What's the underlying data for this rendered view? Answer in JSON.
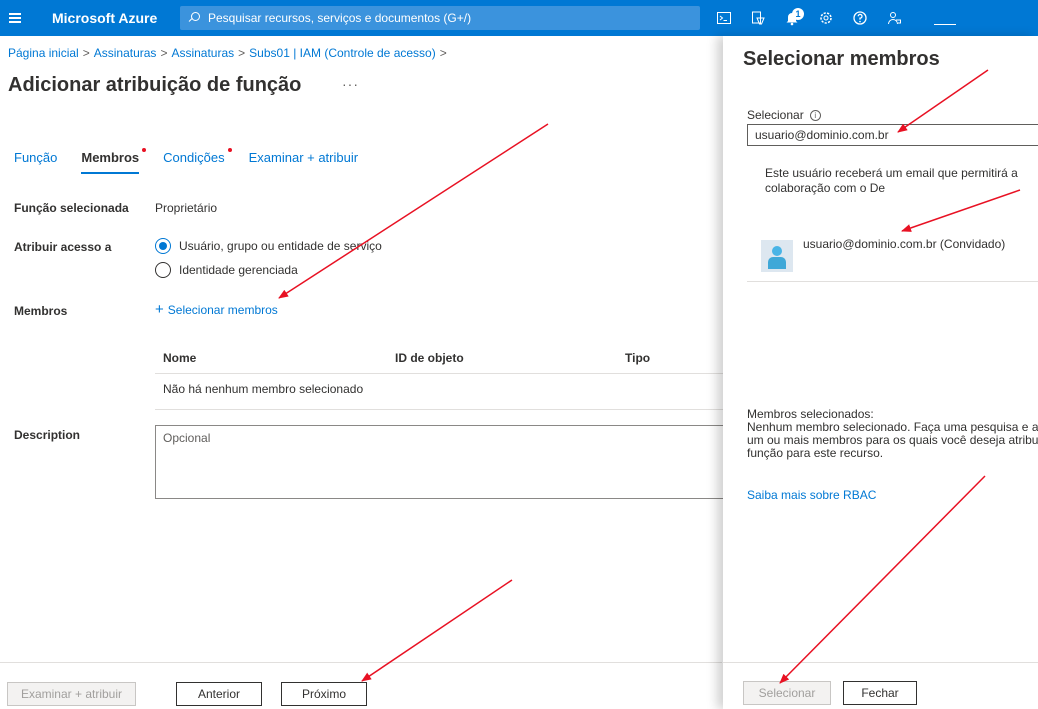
{
  "topbar": {
    "brand": "Microsoft Azure",
    "search_placeholder": "Pesquisar recursos, serviços e documentos (G+/)",
    "notification_count": "1",
    "icons": [
      "menu-icon",
      "search-icon",
      "cloud-shell-icon",
      "directory-filter-icon",
      "notifications-icon",
      "settings-icon",
      "help-icon",
      "feedback-icon"
    ],
    "accent_color": "#0078d4"
  },
  "breadcrumb": [
    "Página inicial",
    "Assinaturas",
    "Assinaturas",
    "Subs01 | IAM (Controle de acesso)"
  ],
  "page": {
    "title": "Adicionar atribuição de função",
    "more": "···"
  },
  "tabs": [
    {
      "label": "Função",
      "active": false,
      "required": false
    },
    {
      "label": "Membros",
      "active": true,
      "required": true
    },
    {
      "label": "Condições",
      "active": false,
      "required": true
    },
    {
      "label": "Examinar + atribuir",
      "active": false,
      "required": false
    }
  ],
  "form": {
    "selected_role_label": "Função selecionada",
    "selected_role_value": "Proprietário",
    "assign_access_label": "Atribuir acesso a",
    "options": [
      "Usuário, grupo ou entidade de serviço",
      "Identidade gerenciada"
    ],
    "selected_option": "Usuário, grupo ou entidade de serviço",
    "members_label": "Membros",
    "select_members_link": "Selecionar membros",
    "table_headers": [
      "Nome",
      "ID de objeto",
      "Tipo"
    ],
    "table_empty": "Não há nenhum membro selecionado",
    "description_label": "Description",
    "description_placeholder": "Opcional"
  },
  "footer": {
    "review_assign": "Examinar + atribuir",
    "previous": "Anterior",
    "next": "Próximo"
  },
  "panel": {
    "title": "Selecionar membros",
    "select_label": "Selecionar",
    "select_value": "usuario@dominio.com.br",
    "note": "Este usuário receberá um email que permitirá a colaboração com o De",
    "result_name": "usuario@dominio.com.br (Convidado)",
    "selected_title": "Membros selecionados:",
    "selected_lines": [
      "Nenhum membro selecionado. Faça uma pesquisa e ad",
      "um ou mais membros para os quais você deseja atribu",
      "função para este recurso."
    ],
    "rbac_link": "Saiba mais sobre RBAC",
    "select_button": "Selecionar",
    "close_button": "Fechar"
  },
  "annotation_color": "#e81123"
}
